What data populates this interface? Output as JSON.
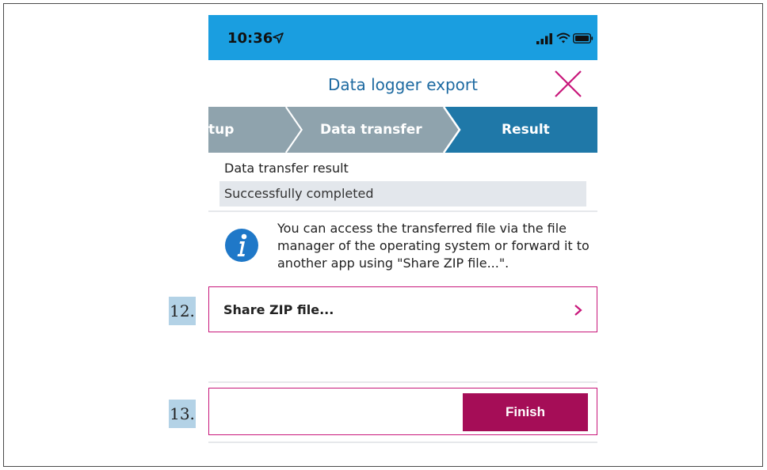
{
  "status_bar": {
    "time": "10:36",
    "icons": [
      "location-arrow-icon",
      "cell-signal-icon",
      "wifi-icon",
      "battery-icon"
    ],
    "background_color": "#1a9ee0"
  },
  "header": {
    "title": "Data logger export",
    "close_icon": "close-x-icon",
    "title_color": "#1d6aa1",
    "close_color": "#c8167a"
  },
  "progress_steps": [
    {
      "label": "tup",
      "state": "done"
    },
    {
      "label": "Data transfer",
      "state": "done"
    },
    {
      "label": "Result",
      "state": "active"
    }
  ],
  "result": {
    "heading": "Data transfer result",
    "value": "Successfully completed"
  },
  "info": {
    "icon": "info-icon",
    "text": "You can access the transferred file via the file manager of the operating system or forward it to another app using \"Share ZIP file...\"."
  },
  "share": {
    "label": "Share ZIP file...",
    "icon": "chevron-right-icon"
  },
  "finish": {
    "label": "Finish",
    "color": "#a50d57"
  },
  "instruction_markers": {
    "share_step": "12.",
    "finish_step": "13."
  },
  "colors": {
    "highlight_border": "#c8167a",
    "step_done": "#8fa3ad",
    "step_active": "#1f78a8"
  }
}
